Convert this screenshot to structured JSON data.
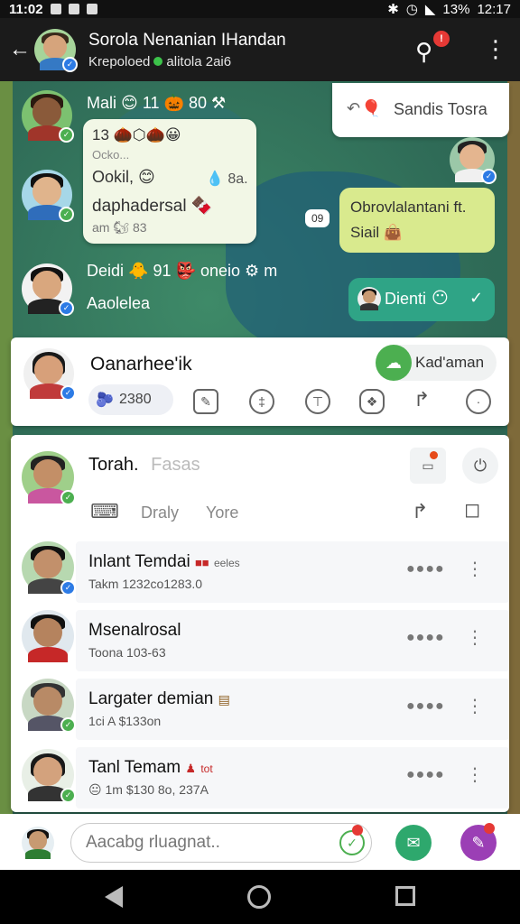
{
  "status_bar": {
    "time": "11:02",
    "battery": "13%",
    "extra": "12:17"
  },
  "header": {
    "title": "Sorola Nenanian IHandan",
    "subtitle_left": "Krepoloed",
    "subtitle_right": "alitola 2ai6",
    "notification_badge": "!"
  },
  "chat": {
    "messages": [
      {
        "sender": "Mali",
        "sender_extra": "11",
        "sender_tail": "80"
      },
      {
        "bubble_line1": "13",
        "bubble_line2": "Ocko...",
        "bubble_line3": "Ookil,",
        "bubble_line3b": "8a.",
        "bubble_line4": "daphadersal",
        "bubble_line5": "am",
        "bubble_line5b": "83"
      },
      {
        "sender": "Deidi",
        "sender_extra": "91",
        "sender_tail": "oneio",
        "sender_tail2": "m"
      },
      {
        "text": "Aaolelea"
      }
    ],
    "top_right_bubble": "Sandis Tosra",
    "lime_bubble_line1": "Obrovlalantani ft.",
    "lime_bubble_line2": "Siail",
    "time_chip": "09",
    "teal_bubble": "Dienti"
  },
  "post_card": {
    "name": "Oanarhee'ik",
    "stat": "2380",
    "button_label": "Kad'aman"
  },
  "list_card": {
    "title": "Torah.",
    "title_hint": "Fasas",
    "tab1": "Draly",
    "tab2": "Yore"
  },
  "contacts": [
    {
      "name": "Inlant Temdai",
      "name_tag": "eeles",
      "sub": "Takm 1232co1283.0"
    },
    {
      "name": "Msenalrosal",
      "name_tag": "",
      "sub": "Toona 103-63"
    },
    {
      "name": "Largater demian",
      "name_tag": "",
      "sub": "1ci A $133on"
    },
    {
      "name": "Tanl Temam",
      "name_tag": "tot",
      "sub": "1m $130 8o, 237A"
    }
  ],
  "composer": {
    "placeholder": "Aacabg rluagnat.."
  },
  "colors": {
    "appbar": "#1b1b1b",
    "lime": "#d9ea8e",
    "teal": "#2fa486",
    "fab_green": "#2ea86d",
    "fab_purple": "#9b3fb5"
  }
}
